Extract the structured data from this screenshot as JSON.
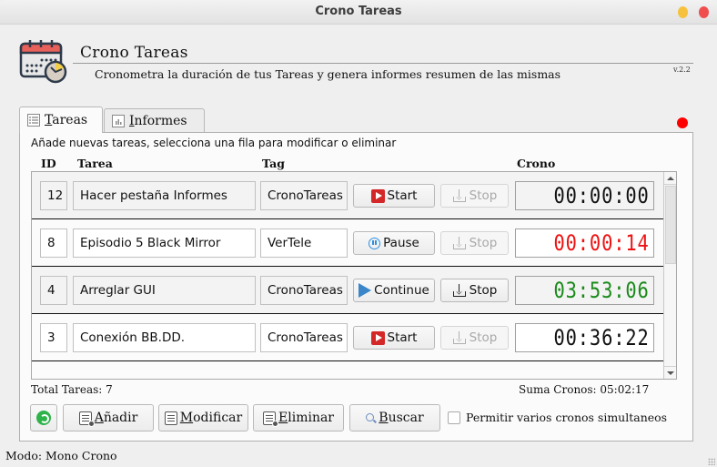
{
  "window": {
    "title": "Crono Tareas",
    "controls": [
      "minimize",
      "close"
    ]
  },
  "header": {
    "icon": "calendar-clock-icon",
    "title": "Crono Tareas",
    "subtitle": "Cronometra la duración de tus Tareas y genera informes resumen de las mismas",
    "version": "v.2.2",
    "status_color": "#ff0000"
  },
  "tabs": [
    {
      "label": "Tareas",
      "mnemonic": "T",
      "rest": "areas",
      "active": true,
      "icon": "list-icon"
    },
    {
      "label": "Informes",
      "mnemonic": "I",
      "rest": "nformes",
      "active": false,
      "icon": "chart-icon"
    }
  ],
  "panel": {
    "instructions": "Añade nuevas tareas, selecciona una fila para modificar o eliminar",
    "columns": {
      "id": "ID",
      "task": "Tarea",
      "tag": "Tag",
      "timer": "Crono"
    },
    "rows": [
      {
        "id": "12",
        "task": "Hacer pestaña Informes",
        "tag": "CronoTareas",
        "action": "Start",
        "action_icon": "play-red",
        "stop": "Stop",
        "stop_enabled": false,
        "time": "00:00:00",
        "time_color": "#111111"
      },
      {
        "id": "8",
        "task": "Episodio 5 Black Mirror",
        "tag": "VerTele",
        "action": "Pause",
        "action_icon": "pause",
        "stop": "Stop",
        "stop_enabled": false,
        "time": "00:00:14",
        "time_color": "#ee1111"
      },
      {
        "id": "4",
        "task": "Arreglar GUI",
        "tag": "CronoTareas",
        "action": "Continue",
        "action_icon": "play-blue",
        "stop": "Stop",
        "stop_enabled": true,
        "time": "03:53:06",
        "time_color": "#1a8a1a"
      },
      {
        "id": "3",
        "task": "Conexión BB.DD.",
        "tag": "CronoTareas",
        "action": "Start",
        "action_icon": "play-red",
        "stop": "Stop",
        "stop_enabled": false,
        "time": "00:36:22",
        "time_color": "#111111"
      }
    ],
    "total_label": "Total Tareas: 7",
    "sum_label": "Suma Cronos: 05:02:17"
  },
  "buttons": {
    "refresh": "refresh-icon",
    "add": {
      "mnemonic": "A",
      "rest": "ñadir"
    },
    "modify": {
      "mnemonic": "M",
      "rest": "odificar"
    },
    "delete": {
      "mnemonic": "E",
      "rest": "liminar"
    },
    "search": {
      "mnemonic": "B",
      "rest": "uscar"
    }
  },
  "options": {
    "multi_timer_label": "Permitir varios cronos simultaneos",
    "multi_timer_checked": false
  },
  "statusbar": {
    "mode": "Modo: Mono Crono"
  }
}
